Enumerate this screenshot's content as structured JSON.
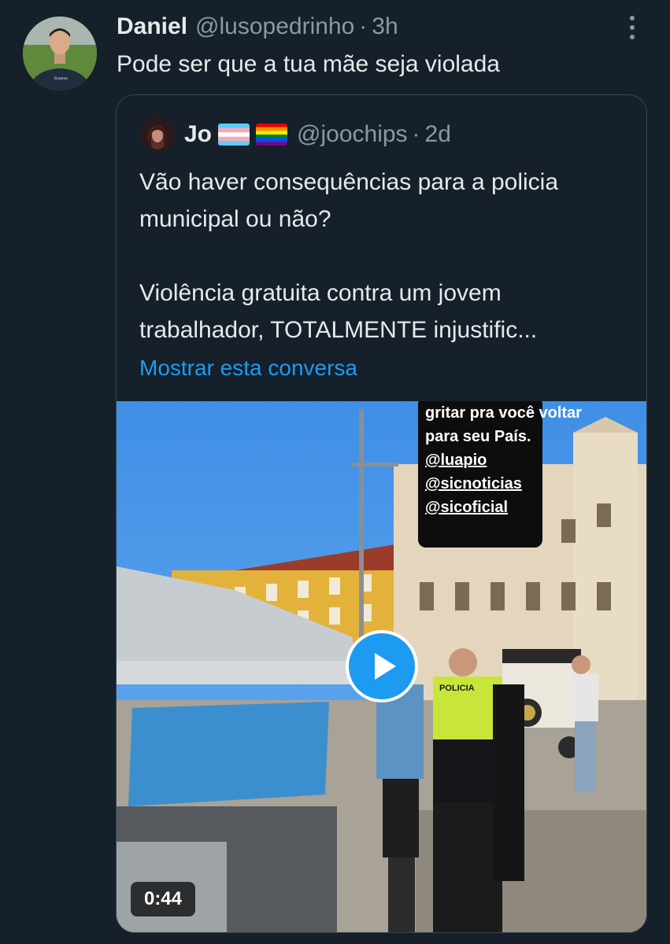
{
  "tweet": {
    "author_name": "Daniel",
    "author_handle": "@lusopedrinho",
    "separator": "·",
    "time": "3h",
    "text": "Pode ser que a tua mãe seja violada",
    "avatar_sweater_text": "Erasmus",
    "more_icon": "more-vertical-icon"
  },
  "quote": {
    "author_name": "Jo",
    "flags": [
      "transgender-flag",
      "rainbow-flag"
    ],
    "author_handle": "@joochips",
    "separator": "·",
    "time": "2d",
    "paragraph1": "Vão haver consequências para a policia municipal ou não?",
    "paragraph2": "Violência gratuita contra um jovem trabalhador, TOTALMENTE injustific...",
    "show_thread": "Mostrar esta conversa",
    "media": {
      "story_lines": [
        "gritar pra você voltar",
        "para seu País.",
        "@luapio",
        "@sicnoticias",
        "@sicoficial"
      ],
      "vest_text": "POLICIA",
      "duration": "0:44",
      "play_icon": "play-icon"
    }
  },
  "colors": {
    "background": "#15202b",
    "text": "#e7e9ea",
    "secondary": "#8b98a5",
    "link": "#1d9bf0",
    "border": "#38444d"
  }
}
